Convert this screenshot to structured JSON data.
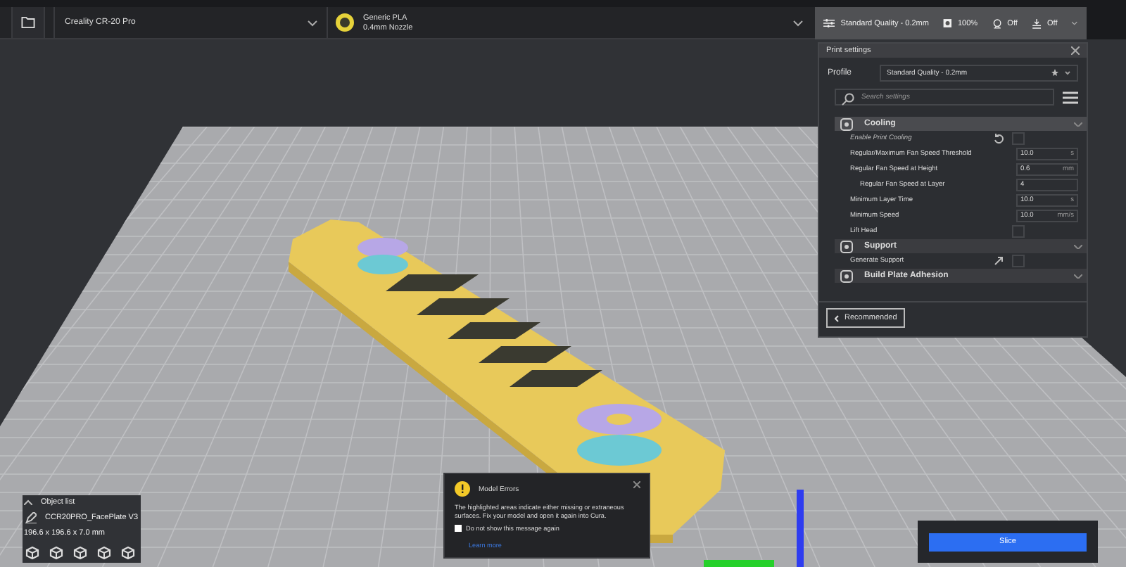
{
  "toolbar": {
    "printer": "Creality CR-20 Pro",
    "material": {
      "name": "Generic PLA",
      "nozzle": "0.4mm Nozzle"
    },
    "quality": "Standard Quality - 0.2mm",
    "infill": "100%",
    "support": "Off",
    "adhesion": "Off"
  },
  "print_settings": {
    "title": "Print settings",
    "profile_label": "Profile",
    "profile": "Standard Quality - 0.2mm",
    "search": {
      "placeholder": "Search settings"
    },
    "rows": [
      {
        "kind": "category",
        "label": "Cooling",
        "selected": true
      },
      {
        "kind": "checkbox",
        "label": "Enable Print Cooling",
        "checked": false,
        "changed": true
      },
      {
        "kind": "value",
        "label": "Regular/Maximum Fan Speed Threshold",
        "value": "10.0",
        "unit": "s"
      },
      {
        "kind": "value",
        "label": "Regular Fan Speed at Height",
        "value": "0.6",
        "unit": "mm",
        "children": [
          {
            "kind": "value",
            "label": "Regular Fan Speed at Layer",
            "value": "4"
          }
        ]
      },
      {
        "kind": "value",
        "label": "Minimum Layer Time",
        "value": "10.0",
        "unit": "s"
      },
      {
        "kind": "value",
        "label": "Minimum Speed",
        "value": "10.0",
        "unit": "mm/s"
      },
      {
        "kind": "checkbox",
        "label": "Lift Head",
        "checked": false,
        "changed": false
      },
      {
        "kind": "category",
        "label": "Support",
        "selected": false
      },
      {
        "kind": "checkbox",
        "label": "Generate Support",
        "checked": false,
        "linked": true,
        "changed": false
      },
      {
        "kind": "category",
        "label": "Build Plate Adhesion",
        "selected": false
      }
    ],
    "back_button": "Recommended"
  },
  "object_list": {
    "title": "Object list",
    "object": "CCR20PRO_FacePlate V3",
    "dimensions": "196.6 x 196.6 x 7.0 mm"
  },
  "message": {
    "title": "Model Errors",
    "text": "The highlighted areas indicate either missing or extraneous surfaces. Fix your model and open it again into Cura.",
    "checkbox": {
      "label": "Do not show this message again",
      "checked": false
    },
    "link": "Learn more"
  },
  "slice_button": "Slice"
}
